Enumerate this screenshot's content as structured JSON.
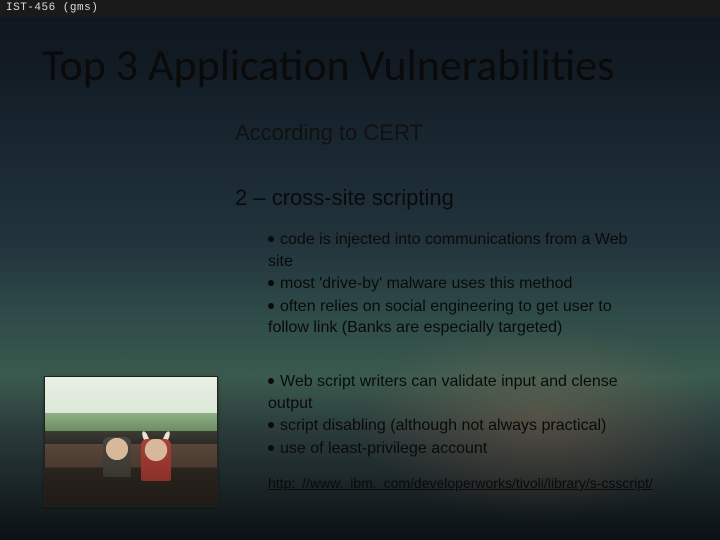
{
  "course_tag": "IST-456 (gms)",
  "title": "Top 3 Application Vulnerabilities",
  "subtitle": "According to CERT",
  "section_heading": "2 – cross-site scripting",
  "bullets_group1": [
    "code is injected into communications from a Web site",
    "most 'drive-by' malware uses this method",
    "often relies on social engineering to get user to follow link  (Banks are especially targeted)"
  ],
  "bullets_group2": [
    "Web script writers can validate input and clense output",
    "script disabling (although not always practical)",
    "use of least-privilege account"
  ],
  "link_text": "http: //www. ibm. com/developerworks/tivoli/library/s-csscript/"
}
